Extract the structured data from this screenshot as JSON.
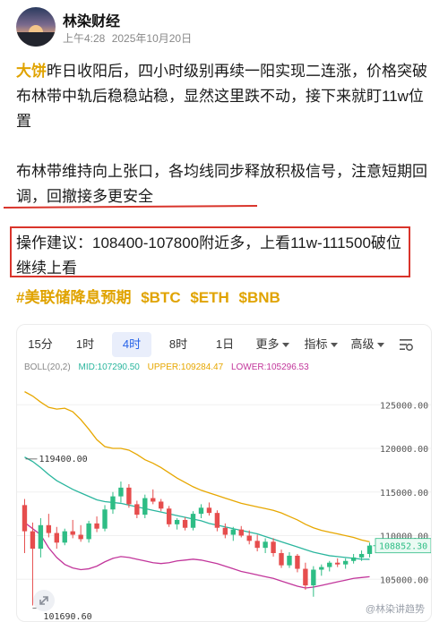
{
  "author": {
    "name": "林染财经",
    "time": "上午4:28",
    "date": "2025年10月20日"
  },
  "post": {
    "p1_accent": "大饼",
    "p1_rest": "昨日收阳后，四小时级别再续一阳实现二连涨，价格突破布林带中轨后稳稳站稳，显然这里跌不动，接下来就盯11w位置",
    "p2": "布林带维持向上张口，各均线同步释放积极信号，注意短期回调，回撤接多更安全",
    "advice": "操作建议：108400-107800附近多，上看11w-111500破位继续上看",
    "tags": [
      "#美联储降息预期",
      "$BTC",
      "$ETH",
      "$BNB"
    ]
  },
  "chart": {
    "tabs": [
      "15分",
      "1时",
      "4时",
      "8时",
      "1日",
      "更多",
      "指标",
      "高级"
    ],
    "active_tab": "4时",
    "boll": {
      "label": "BOLL(20,2)",
      "mid_label": "MID:107290.50",
      "upper_label": "UPPER:109284.47",
      "lower_label": "LOWER:105296.53"
    },
    "colors": {
      "mid": "#2bb69e",
      "upper": "#e7a700",
      "lower": "#c2369b",
      "up": "#2ebd85",
      "down": "#e64d4d",
      "accent": "#2864e8"
    },
    "price_ticks": [
      "125000.00",
      "120000.00",
      "115000.00",
      "110000.00",
      "105000.00"
    ],
    "current_price": "108852.30",
    "high_label": "119400.00",
    "low_label": "101690.60",
    "watermark": "@林染讲趋势"
  },
  "chart_data": {
    "type": "candlestick",
    "indicator": "BOLL(20,2)",
    "ylim": [
      100000,
      128000
    ],
    "ohlc": [
      [
        113500,
        114200,
        108000,
        110500
      ],
      [
        110500,
        111500,
        102000,
        108500
      ],
      [
        108500,
        112000,
        107500,
        111200
      ],
      [
        111200,
        112500,
        109800,
        110300
      ],
      [
        110300,
        111000,
        108500,
        109200
      ],
      [
        109200,
        110800,
        108900,
        110500
      ],
      [
        110500,
        111800,
        109700,
        110100
      ],
      [
        110100,
        111200,
        109300,
        109600
      ],
      [
        109600,
        111700,
        109200,
        111400
      ],
      [
        111400,
        112200,
        110400,
        110800
      ],
      [
        110800,
        113500,
        110500,
        113000
      ],
      [
        113000,
        115000,
        112500,
        114500
      ],
      [
        114500,
        116200,
        113800,
        115500
      ],
      [
        115500,
        115900,
        113200,
        113600
      ],
      [
        113600,
        114000,
        112000,
        112400
      ],
      [
        112400,
        114700,
        112000,
        114300
      ],
      [
        114300,
        115300,
        113600,
        113900
      ],
      [
        113900,
        114200,
        112800,
        113100
      ],
      [
        113100,
        113400,
        111000,
        111300
      ],
      [
        111300,
        112000,
        110700,
        111800
      ],
      [
        111800,
        112100,
        110600,
        110900
      ],
      [
        110900,
        112800,
        110600,
        112500
      ],
      [
        112500,
        113600,
        112000,
        113200
      ],
      [
        113200,
        113800,
        112300,
        112600
      ],
      [
        112600,
        112900,
        110500,
        110900
      ],
      [
        110900,
        111400,
        109700,
        110100
      ],
      [
        110100,
        111000,
        109400,
        110700
      ],
      [
        110700,
        111100,
        109800,
        110000
      ],
      [
        110000,
        110600,
        109000,
        109400
      ],
      [
        109400,
        110100,
        108200,
        108600
      ],
      [
        108600,
        109700,
        108000,
        109300
      ],
      [
        109300,
        109700,
        107600,
        108000
      ],
      [
        108000,
        108400,
        106300,
        106600
      ],
      [
        106600,
        108100,
        106300,
        107700
      ],
      [
        107700,
        107900,
        105800,
        106200
      ],
      [
        106200,
        106900,
        103800,
        104300
      ],
      [
        104300,
        106500,
        103000,
        106100
      ],
      [
        106100,
        106700,
        105400,
        106400
      ],
      [
        106400,
        107100,
        105900,
        106900
      ],
      [
        106900,
        107400,
        106400,
        106700
      ],
      [
        106700,
        107400,
        106200,
        107100
      ],
      [
        107100,
        107900,
        106800,
        107500
      ],
      [
        107500,
        108300,
        107100,
        107900
      ],
      [
        107900,
        109200,
        107500,
        108852.3
      ]
    ],
    "upper_band": [
      126500,
      126000,
      125300,
      124700,
      124500,
      124600,
      124200,
      123300,
      122200,
      121000,
      120200,
      120000,
      120000,
      119800,
      119300,
      118700,
      118300,
      117800,
      117200,
      116600,
      116100,
      115600,
      115200,
      114900,
      114600,
      114300,
      114000,
      113700,
      113500,
      113300,
      113100,
      112900,
      112600,
      112200,
      111800,
      111300,
      110900,
      110600,
      110400,
      110200,
      110000,
      109800,
      109500,
      109300
    ],
    "mid_band": [
      119000,
      118500,
      117800,
      117000,
      116300,
      115800,
      115300,
      114900,
      114500,
      114100,
      113900,
      113800,
      113700,
      113500,
      113300,
      113100,
      112900,
      112700,
      112500,
      112300,
      112100,
      111900,
      111700,
      111400,
      111200,
      111000,
      110800,
      110600,
      110400,
      110200,
      109900,
      109600,
      109300,
      109000,
      108700,
      108400,
      108100,
      107900,
      107700,
      107600,
      107500,
      107400,
      107300,
      107290.5
    ],
    "lower_band": [
      111500,
      110800,
      110100,
      108600,
      107500,
      106700,
      106300,
      106100,
      106200,
      106500,
      107000,
      107400,
      107600,
      107500,
      107300,
      107100,
      106900,
      106800,
      106900,
      107100,
      107200,
      107300,
      107200,
      107000,
      106800,
      106500,
      106200,
      105900,
      105700,
      105500,
      105300,
      105100,
      104800,
      104500,
      104200,
      104000,
      104100,
      104300,
      104500,
      104700,
      104900,
      105100,
      105200,
      105296.53
    ]
  }
}
